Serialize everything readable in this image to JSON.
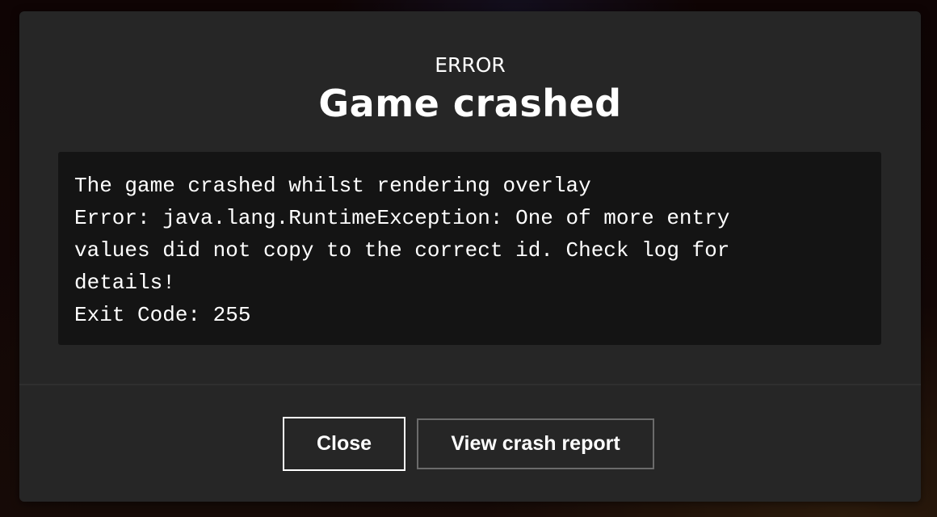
{
  "dialog": {
    "eyebrow": "ERROR",
    "title": "Game crashed",
    "message_lines": [
      "The game crashed whilst rendering overlay",
      "Error: java.lang.RuntimeException: One of more entry",
      "values did not copy to the correct id. Check log for",
      "details!",
      "Exit Code: 255"
    ],
    "buttons": {
      "close_label": "Close",
      "view_report_label": "View crash report"
    }
  },
  "colors": {
    "modal_bg": "#262626",
    "code_bg": "#141414",
    "text": "#ffffff",
    "primary_button_border": "#ffffff",
    "secondary_button_border": "#6b6b6b"
  }
}
